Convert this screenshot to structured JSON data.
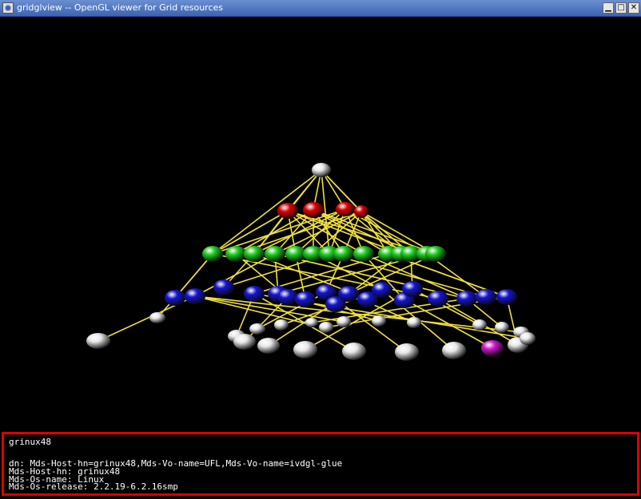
{
  "window": {
    "title": "gridglview -- OpenGL viewer for Grid resources",
    "controls": {
      "minimize": "▁",
      "maximize": "□",
      "close": "✕"
    }
  },
  "scene": {
    "background": "#000000",
    "edge_color": "#f0e040",
    "node_colors": {
      "root": "#ffffff",
      "level1": "#e00000",
      "level2": "#22cc22",
      "level3": "#1515d0",
      "leaf": "#ffffff",
      "selected": "#d018d0"
    }
  },
  "info": {
    "selected_name": "grinux48",
    "dn": "dn: Mds-Host-hn=grinux48,Mds-Vo-name=UFL,Mds-Vo-name=ivdgl-glue",
    "host": "Mds-Host-hn: grinux48",
    "os_name": "Mds-Os-name: Linux",
    "os_release": "Mds-Os-release: 2.2.19-6.2.16smp",
    "border_color": "#e00000"
  }
}
